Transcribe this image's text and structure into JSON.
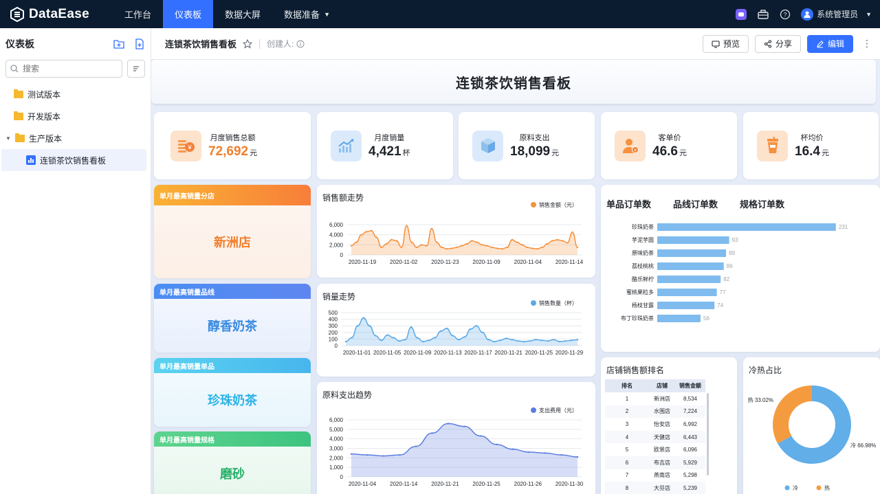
{
  "app": {
    "logo": "DataEase",
    "nav": [
      {
        "label": "工作台"
      },
      {
        "label": "仪表板"
      },
      {
        "label": "数据大屏"
      },
      {
        "label": "数据准备"
      }
    ],
    "user": "系统管理员"
  },
  "sidebar": {
    "title": "仪表板",
    "search_placeholder": "搜索",
    "items": [
      {
        "label": "测试版本"
      },
      {
        "label": "开发版本"
      },
      {
        "label": "生产版本"
      },
      {
        "label": "连锁茶饮销售看板"
      }
    ]
  },
  "header": {
    "title": "连锁茶饮销售看板",
    "creator": "创建人:",
    "preview": "预览",
    "share": "分享",
    "edit": "编辑"
  },
  "dashboard": {
    "title": "连锁茶饮销售看板",
    "kpis": [
      {
        "label": "月度销售总额",
        "value": "72,692",
        "unit": "元",
        "color": "#f07f2d",
        "icon": "coins-icon"
      },
      {
        "label": "月度销量",
        "value": "4,421",
        "unit": "杯",
        "color": "#1f2329",
        "icon": "trend-chart-icon"
      },
      {
        "label": "原料支出",
        "value": "18,099",
        "unit": "元",
        "color": "#1f2329",
        "icon": "box-icon"
      },
      {
        "label": "客单价",
        "value": "46.6",
        "unit": "元",
        "color": "#1f2329",
        "icon": "customer-icon"
      },
      {
        "label": "杯均价",
        "value": "16.4",
        "unit": "元",
        "color": "#1f2329",
        "icon": "cup-icon"
      }
    ],
    "tags": [
      {
        "header": "单月最高销量分店",
        "value": "新洲店",
        "color": "#f07f2d"
      },
      {
        "header": "单月最高销量品线",
        "value": "醇香奶茶",
        "color": "#3a8be0"
      },
      {
        "header": "单月最高销量单品",
        "value": "珍珠奶茶",
        "color": "#2db3e6"
      },
      {
        "header": "单月最高销量规格",
        "value": "磨砂",
        "color": "#27b06a"
      }
    ],
    "tabs": [
      "单品订单数",
      "品线订单数",
      "规格订单数"
    ],
    "rank": {
      "title": "店铺销售额排名",
      "columns": [
        "排名",
        "店铺",
        "销售金额"
      ],
      "rows": [
        [
          "1",
          "新洲店",
          "8,534"
        ],
        [
          "2",
          "水围店",
          "7,224"
        ],
        [
          "3",
          "怡安店",
          "6,992"
        ],
        [
          "4",
          "天健店",
          "6,443"
        ],
        [
          "5",
          "欧景店",
          "6,096"
        ],
        [
          "6",
          "布吉店",
          "5,929"
        ],
        [
          "7",
          "燕南店",
          "5,298"
        ],
        [
          "8",
          "大芬店",
          "5,239"
        ]
      ]
    }
  },
  "chart_data": [
    {
      "type": "area",
      "title": "销售额走势",
      "series": [
        {
          "name": "销售金额（元）",
          "color": "#f5923e",
          "values": [
            1800,
            2500,
            4000,
            4600,
            4800,
            3500,
            1500,
            2200,
            3000,
            2800,
            1500,
            5800,
            2500,
            1500,
            2000,
            1800,
            5200,
            2500,
            1500,
            1200,
            1300,
            1500,
            1800,
            2200,
            2800,
            2500,
            2000,
            1800,
            1500,
            1300,
            1200,
            1500,
            3000,
            2500,
            2000,
            1500,
            1300,
            1200,
            1500,
            2200,
            2800,
            3000,
            2800,
            2400,
            4500,
            1500
          ]
        }
      ],
      "ylim": [
        0,
        6000
      ],
      "yticks": [
        "6,000",
        "4,000",
        "2,000",
        "0"
      ],
      "xticks": [
        "2020-11-19",
        "2020-11-02",
        "2020-11-23",
        "2020-11-09",
        "2020-11-04",
        "2020-11-14"
      ]
    },
    {
      "type": "area",
      "title": "销量走势",
      "series": [
        {
          "name": "销售数量（杯）",
          "color": "#5aa9e6",
          "values": [
            60,
            120,
            300,
            420,
            300,
            150,
            80,
            160,
            120,
            70,
            90,
            280,
            120,
            60,
            80,
            120,
            220,
            260,
            150,
            90,
            130,
            250,
            300,
            200,
            90,
            60,
            80,
            110,
            90,
            70,
            60,
            70,
            90,
            80,
            70,
            90,
            60,
            70,
            80,
            90
          ]
        }
      ],
      "ylim": [
        0,
        500
      ],
      "yticks": [
        "500",
        "400",
        "300",
        "200",
        "100",
        "0"
      ],
      "xticks": [
        "2020-11-01",
        "2020-11-05",
        "2020-11-09",
        "2020-11-13",
        "2020-11-17",
        "2020-11-21",
        "2020-11-25",
        "2020-11-29"
      ]
    },
    {
      "type": "area",
      "title": "原料支出趋势",
      "series": [
        {
          "name": "支出费用（元）",
          "color": "#5b7de0",
          "values": [
            2400,
            2300,
            2200,
            2300,
            3200,
            4600,
            5600,
            5300,
            4300,
            3400,
            2900,
            2600,
            2500,
            2300,
            2100
          ]
        }
      ],
      "ylim": [
        0,
        6000
      ],
      "yticks": [
        "6,000",
        "5,000",
        "4,000",
        "3,000",
        "2,000",
        "1,000",
        "0"
      ],
      "xticks": [
        "2020-11-04",
        "2020-11-14",
        "2020-11-21",
        "2020-11-25",
        "2020-11-26",
        "2020-11-30"
      ]
    },
    {
      "type": "bar",
      "orientation": "horizontal",
      "categories": [
        "珍珠奶茶",
        "芋泥芋圆",
        "原味奶茶",
        "荔枝桃桃",
        "酪乐鲜柠",
        "蜜桃果粒多",
        "杨枝甘露",
        "布丁珍珠奶茶"
      ],
      "values": [
        231,
        93,
        89,
        86,
        82,
        77,
        74,
        56
      ],
      "xlim": [
        0,
        240
      ]
    },
    {
      "type": "pie",
      "title": "冷热占比",
      "categories": [
        "冷",
        "热"
      ],
      "values": [
        66.98,
        33.02
      ],
      "labels": [
        "冷 66.98%",
        "热 33.02%"
      ],
      "colors": [
        "#61aee8",
        "#f59b3f"
      ]
    }
  ]
}
